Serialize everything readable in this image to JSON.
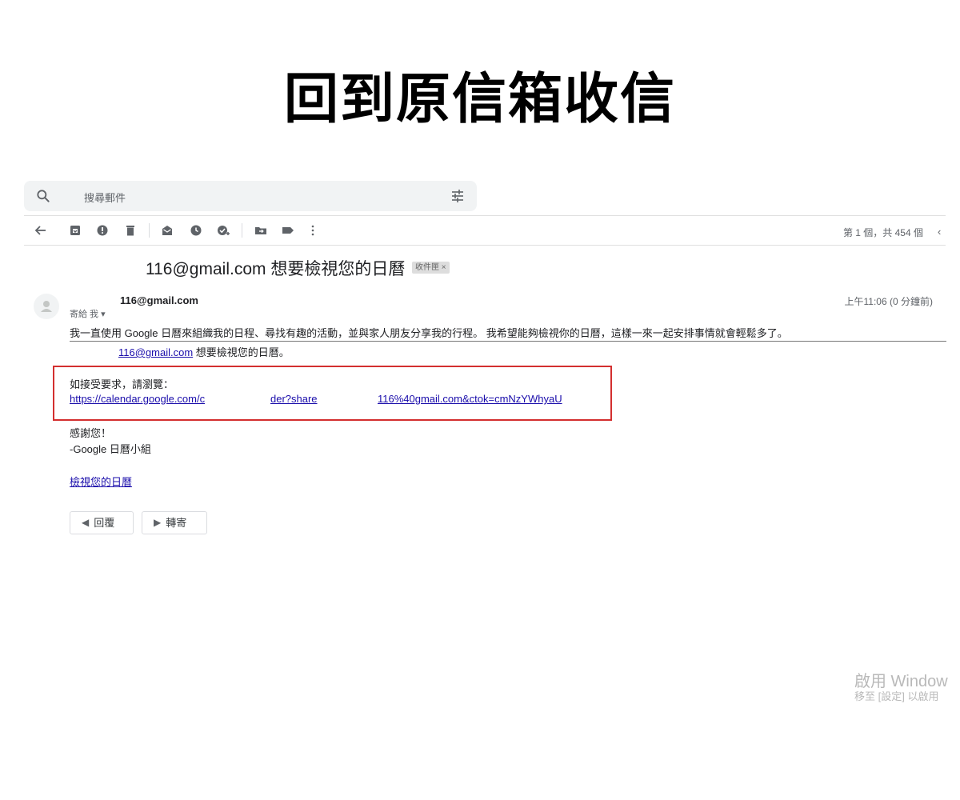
{
  "headline": "回到原信箱收信",
  "search": {
    "placeholder": "搜尋郵件"
  },
  "icons": {
    "search": "search-icon",
    "filter": "tune-icon",
    "back": "arrow-left-icon",
    "archive": "archive-icon",
    "spam": "report-spam-icon",
    "delete": "trash-icon",
    "mark_unread": "mark-unread-icon",
    "snooze": "clock-icon",
    "add_task": "add-task-icon",
    "move": "move-to-icon",
    "label": "label-icon",
    "more": "more-vert-icon"
  },
  "toolbar": {
    "pager": "第 1 個，共 454 個",
    "prev": "‹"
  },
  "email": {
    "subject": "116@gmail.com 想要檢視您的日曆",
    "label_chip": "收件匣 ×",
    "sender": "116@gmail.com",
    "to_me": "寄給 我 ▾",
    "timestamp": "上午11:06 (0 分鐘前)",
    "message": "我一直使用 Google 日曆來組織我的日程、尋找有趣的活動，並與家人朋友分享我的行程。 我希望能夠檢視你的日曆，這樣一來一起安排事情就會輕鬆多了。",
    "request_email": "116@gmail.com",
    "request_suffix": " 想要檢視您的日曆。",
    "accept_prompt": "如接受要求，請瀏覽：",
    "link_part1": "https://calendar.google.com/c",
    "link_part2": "der?share",
    "link_part3": "116%40gmail.com&ctok=cmNzYWhyaU",
    "thanks": "感謝您！",
    "signature": "-Google 日曆小組",
    "view_calendar": "檢視您的日曆"
  },
  "actions": {
    "reply": "回覆",
    "forward": "轉寄"
  },
  "colors": {
    "highlight_border": "#d32f2f",
    "link": "#1a0dab"
  },
  "watermark": {
    "line1": "啟用 Window",
    "line2": "移至 [設定] 以啟用"
  }
}
